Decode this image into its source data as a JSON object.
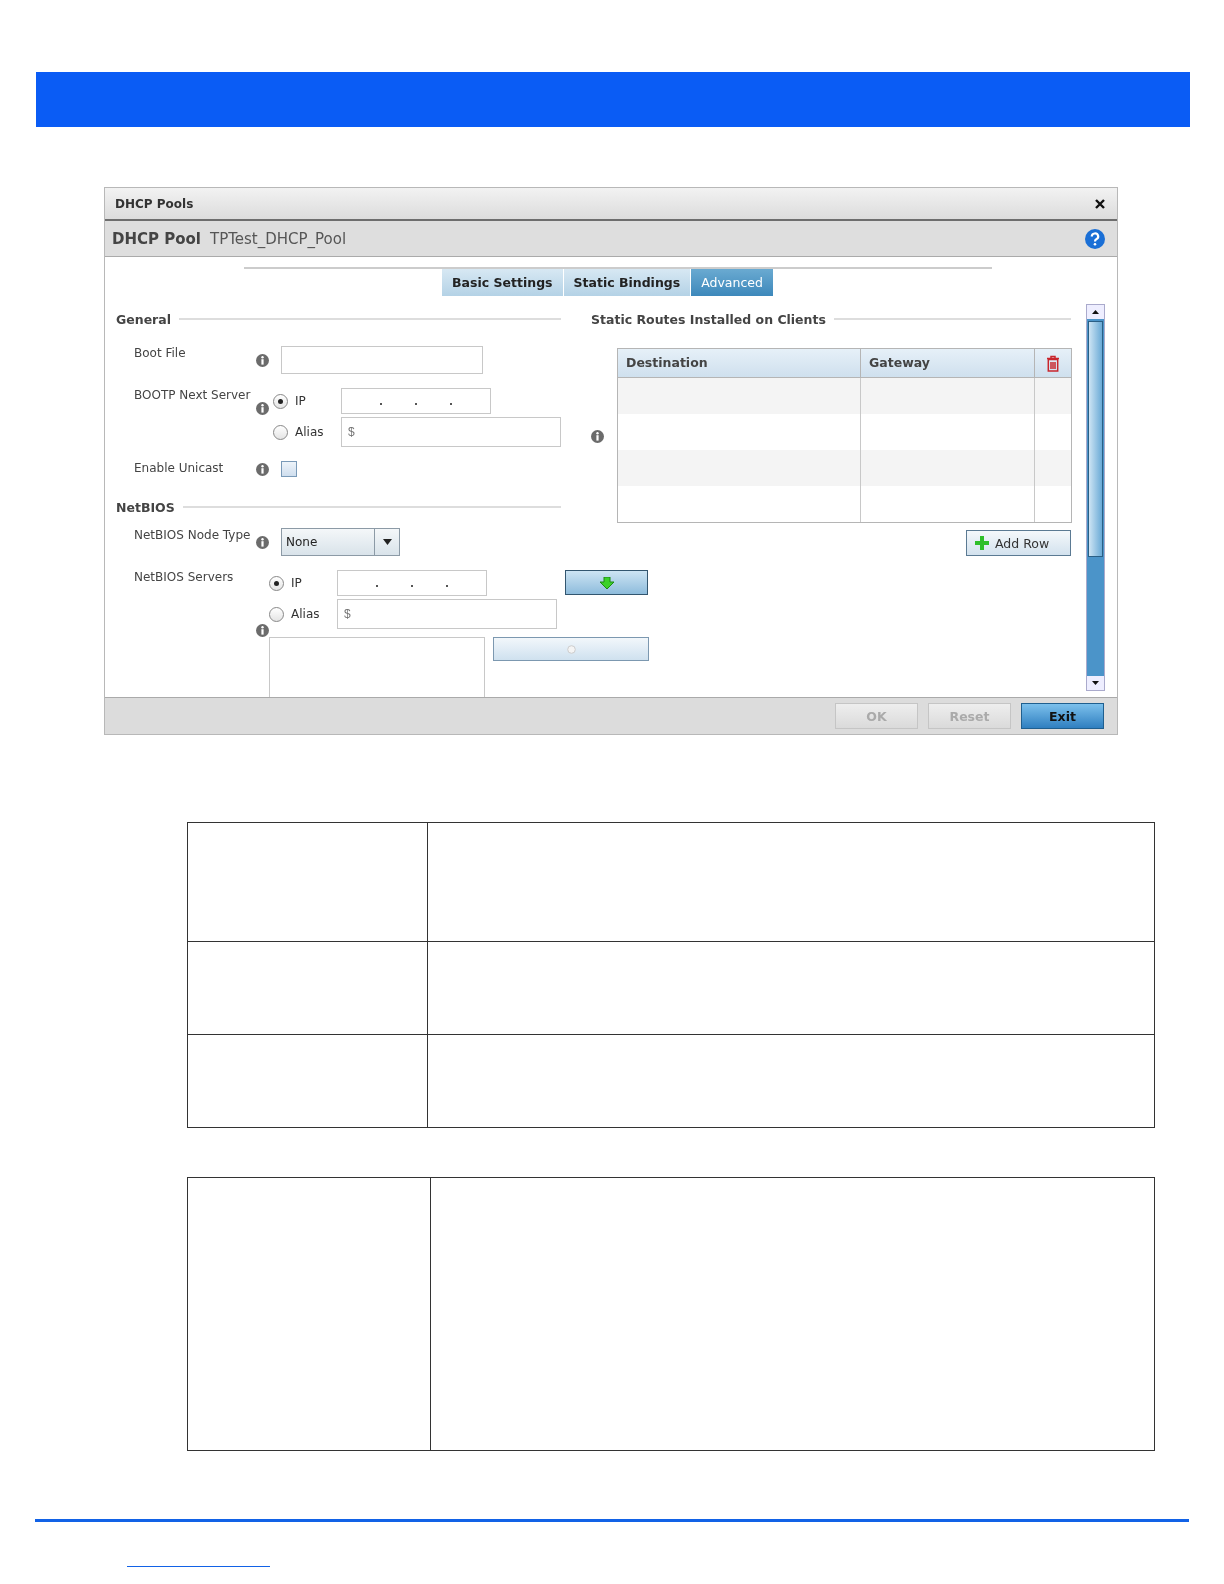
{
  "dialog": {
    "title": "DHCP Pools",
    "header_label": "DHCP Pool",
    "header_value": "TPTest_DHCP_Pool",
    "tabs": [
      {
        "label": "Basic Settings",
        "selected": false
      },
      {
        "label": "Static Bindings",
        "selected": false
      },
      {
        "label": "Advanced",
        "selected": true
      }
    ],
    "general": {
      "title": "General",
      "boot_file": {
        "label": "Boot File"
      },
      "bootp_next_server": {
        "label": "BOOTP Next Server",
        "options": [
          {
            "label": "IP",
            "selected": true
          },
          {
            "label": "Alias",
            "selected": false
          }
        ],
        "alias_placeholder": "$"
      },
      "enable_unicast": {
        "label": "Enable Unicast",
        "checked": false
      }
    },
    "netbios": {
      "title": "NetBIOS",
      "node_type": {
        "label": "NetBIOS Node Type",
        "value": "None"
      },
      "servers": {
        "label": "NetBIOS Servers",
        "options": [
          {
            "label": "IP",
            "selected": true
          },
          {
            "label": "Alias",
            "selected": false
          }
        ],
        "alias_placeholder": "$"
      }
    },
    "static_routes": {
      "title": "Static Routes Installed on Clients",
      "columns": [
        "Destination",
        "Gateway"
      ],
      "add_button": "Add Row"
    },
    "buttons": [
      {
        "label": "OK",
        "disabled": true
      },
      {
        "label": "Reset",
        "disabled": true
      },
      {
        "label": "Exit",
        "disabled": false
      }
    ]
  }
}
